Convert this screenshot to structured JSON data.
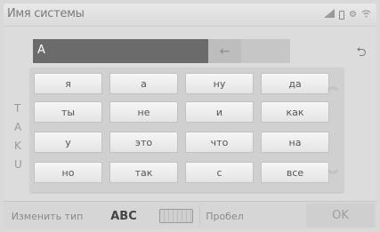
{
  "header": {
    "title": "Имя системы",
    "status_icons": [
      "signal-icon",
      "battery-icon",
      "gear-icon",
      "wifi-icon"
    ]
  },
  "input": {
    "value": "A",
    "backspace_glyph": "←",
    "back_glyph": "⮌"
  },
  "background_keys": [
    "T",
    "A",
    "K",
    "U"
  ],
  "suggestions": {
    "rows": [
      [
        "я",
        "а",
        "ну",
        "да"
      ],
      [
        "ты",
        "не",
        "и",
        "как"
      ],
      [
        "у",
        "это",
        "что",
        "на"
      ],
      [
        "но",
        "так",
        "с",
        "все"
      ]
    ],
    "scroll_up_glyph": "︽",
    "scroll_down_glyph": "︾"
  },
  "bottom": {
    "change_type": "Изменить тип",
    "abc": "ABC",
    "space": "Пробел",
    "ok": "OK"
  }
}
